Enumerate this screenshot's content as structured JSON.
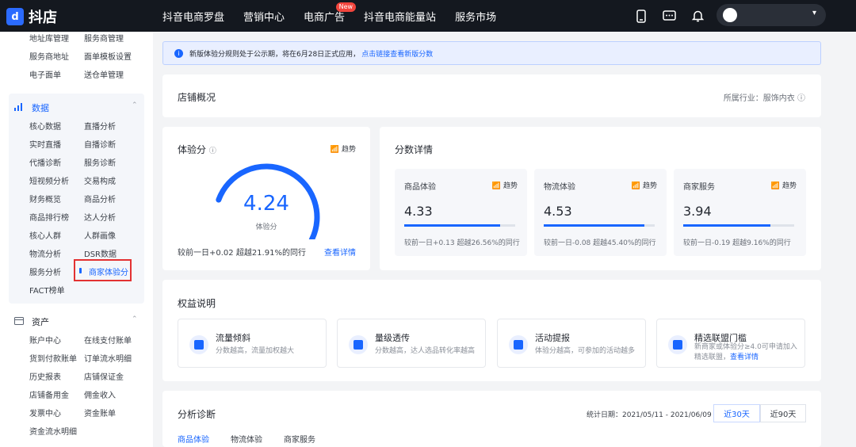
{
  "header": {
    "logo_glyph": "d",
    "brand": "抖店",
    "nav": [
      "抖音电商罗盘",
      "营销中心",
      "电商广告",
      "抖音电商能量站",
      "服务市场"
    ],
    "nav_badge": "New",
    "user_caret": "▾"
  },
  "sidebar": {
    "top_rows": [
      [
        "地址库管理",
        "服务商管理"
      ],
      [
        "服务商地址",
        "面单模板设置"
      ],
      [
        "电子面单",
        "送仓单管理"
      ]
    ],
    "data_group": {
      "title": "数据",
      "rows": [
        [
          "核心数据",
          "直播分析"
        ],
        [
          "实时直播",
          "自播诊断"
        ],
        [
          "代播诊断",
          "服务诊断"
        ],
        [
          "短视频分析",
          "交易构成"
        ],
        [
          "财务概览",
          "商品分析"
        ],
        [
          "商品排行榜",
          "达人分析"
        ],
        [
          "核心人群",
          "人群画像"
        ],
        [
          "物流分析",
          "DSR数据"
        ],
        [
          "服务分析",
          "商家体验分"
        ],
        [
          "FACT榜单",
          ""
        ]
      ]
    },
    "asset_group": {
      "title": "资产",
      "rows": [
        [
          "账户中心",
          "在线支付账单"
        ],
        [
          "货到付款账单",
          "订单流水明细"
        ],
        [
          "历史报表",
          "店铺保证金"
        ],
        [
          "店铺备用金",
          "佣金收入"
        ],
        [
          "发票中心",
          "资金账单"
        ],
        [
          "资金流水明细",
          ""
        ]
      ]
    }
  },
  "notice": {
    "text": "新版体验分规则处于公示期，将在6月28日正式应用，",
    "link": "点击链接查看新版分数"
  },
  "overview": {
    "title": "店铺概况",
    "industry": "所属行业：服饰内衣"
  },
  "score": {
    "title": "体验分",
    "trend_label": "趋势",
    "value": "4.24",
    "gauge_label": "体验分",
    "gauge_fraction": 0.848,
    "compare": "较前一日+0.02 超越21.91%的同行",
    "detail_link": "查看详情"
  },
  "details": {
    "title": "分数详情",
    "items": [
      {
        "name": "商品体验",
        "trend": "趋势",
        "value": "4.33",
        "fraction": 0.866,
        "compare": "较前一日+0.13 超越26.56%的同行"
      },
      {
        "name": "物流体验",
        "trend": "趋势",
        "value": "4.53",
        "fraction": 0.906,
        "compare": "较前一日-0.08 超越45.40%的同行"
      },
      {
        "name": "商家服务",
        "trend": "趋势",
        "value": "3.94",
        "fraction": 0.788,
        "compare": "较前一日-0.19 超越9.16%的同行"
      }
    ]
  },
  "benefits": {
    "title": "权益说明",
    "items": [
      {
        "name": "流量倾斜",
        "desc": "分数越高，流量加权越大"
      },
      {
        "name": "量级透传",
        "desc": "分数越高，达人选品转化率越高"
      },
      {
        "name": "活动提报",
        "desc": "体验分越高，可参加的活动越多"
      },
      {
        "name": "精选联盟门槛",
        "desc": "新商家或体验分≥4.0可申请加入",
        "desc2": "精选联盟，",
        "link": "查看详情"
      }
    ]
  },
  "analysis": {
    "title": "分析诊断",
    "date_range": "统计日期：2021/05/11 - 2021/06/09",
    "ranges": [
      "近30天",
      "近90天"
    ],
    "subtabs": [
      "商品体验",
      "物流体验",
      "商家服务"
    ]
  },
  "colors": {
    "accent": "#1966ff",
    "header_bg": "#14181f",
    "highlight_border": "#e33232"
  },
  "icons": {
    "trend": "trend-icon",
    "help": "help-icon",
    "info": "info-icon",
    "phone": "phone-icon",
    "chat": "chat-icon",
    "bell": "bell-icon"
  }
}
